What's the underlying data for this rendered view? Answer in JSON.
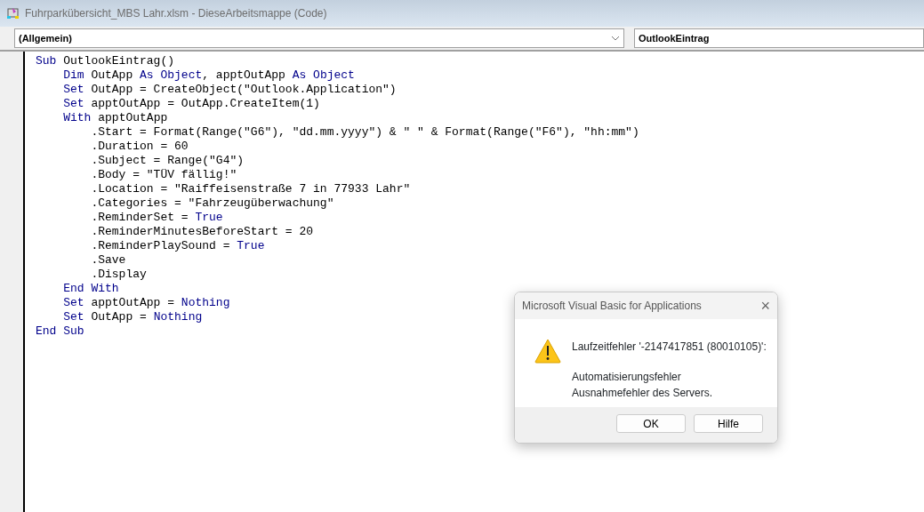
{
  "window": {
    "title": "Fuhrparkübersicht_MBS Lahr.xlsm - DieseArbeitsmappe (Code)"
  },
  "object_dropdown": {
    "value": "(Allgemein)"
  },
  "procedure_dropdown": {
    "value": "OutlookEintrag"
  },
  "code_lines": [
    {
      "tokens": [
        {
          "kind": "keyword",
          "text": "Sub"
        },
        {
          "kind": "text",
          "text": " OutlookEintrag()"
        }
      ],
      "children": [
        {
          "tokens": [
            {
              "kind": "keyword",
              "text": "Dim"
            },
            {
              "kind": "text",
              "text": " OutApp "
            },
            {
              "kind": "keyword",
              "text": "As Object"
            },
            {
              "kind": "text",
              "text": ", apptOutApp "
            },
            {
              "kind": "keyword",
              "text": "As Object"
            }
          ]
        },
        {
          "tokens": [
            {
              "kind": "keyword",
              "text": "Set"
            },
            {
              "kind": "text",
              "text": " OutApp = CreateObject(\"Outlook.Application\")"
            }
          ]
        },
        {
          "tokens": [
            {
              "kind": "keyword",
              "text": "Set"
            },
            {
              "kind": "text",
              "text": " apptOutApp = OutApp.CreateItem(1)"
            }
          ]
        },
        {
          "tokens": [
            {
              "kind": "keyword",
              "text": "With"
            },
            {
              "kind": "text",
              "text": " apptOutApp"
            }
          ],
          "children": [
            {
              "tokens": [
                {
                  "kind": "text",
                  "text": ".Start = Format(Range(\"G6\"), \"dd.mm.yyyy\") & \" \" & Format(Range(\"F6\"), \"hh:mm\")"
                }
              ]
            },
            {
              "tokens": [
                {
                  "kind": "text",
                  "text": ".Duration = 60"
                }
              ]
            },
            {
              "tokens": [
                {
                  "kind": "text",
                  "text": ".Subject = Range(\"G4\")"
                }
              ]
            },
            {
              "tokens": [
                {
                  "kind": "text",
                  "text": ".Body = \"TÜV fällig!\""
                }
              ]
            },
            {
              "tokens": [
                {
                  "kind": "text",
                  "text": ".Location = \"Raiffeisenstraße 7 in 77933 Lahr\""
                }
              ]
            },
            {
              "tokens": [
                {
                  "kind": "text",
                  "text": ".Categories = \"Fahrzeugüberwachung\""
                }
              ]
            },
            {
              "tokens": [
                {
                  "kind": "text",
                  "text": ".ReminderSet = "
                },
                {
                  "kind": "keyword",
                  "text": "True"
                }
              ]
            },
            {
              "tokens": [
                {
                  "kind": "text",
                  "text": ".ReminderMinutesBeforeStart = 20"
                }
              ]
            },
            {
              "tokens": [
                {
                  "kind": "text",
                  "text": ".ReminderPlaySound = "
                },
                {
                  "kind": "keyword",
                  "text": "True"
                }
              ]
            },
            {
              "tokens": [
                {
                  "kind": "text",
                  "text": ".Save"
                }
              ]
            },
            {
              "tokens": [
                {
                  "kind": "text",
                  "text": ".Display"
                }
              ]
            }
          ]
        },
        {
          "tokens": [
            {
              "kind": "keyword",
              "text": "End With"
            }
          ]
        },
        {
          "tokens": [
            {
              "kind": "keyword",
              "text": "Set"
            },
            {
              "kind": "text",
              "text": " apptOutApp = "
            },
            {
              "kind": "keyword",
              "text": "Nothing"
            }
          ]
        },
        {
          "tokens": [
            {
              "kind": "keyword",
              "text": "Set"
            },
            {
              "kind": "text",
              "text": " OutApp = "
            },
            {
              "kind": "keyword",
              "text": "Nothing"
            }
          ]
        }
      ]
    },
    {
      "tokens": [
        {
          "kind": "keyword",
          "text": "End Sub"
        }
      ]
    }
  ],
  "dialog": {
    "title": "Microsoft Visual Basic for Applications",
    "close": "×",
    "heading": "Laufzeitfehler '-2147417851 (80010105)':",
    "message_lines": [
      "Automatisierungsfehler",
      "Ausnahmefehler des Servers."
    ],
    "buttons": [
      "OK",
      "Hilfe"
    ]
  }
}
